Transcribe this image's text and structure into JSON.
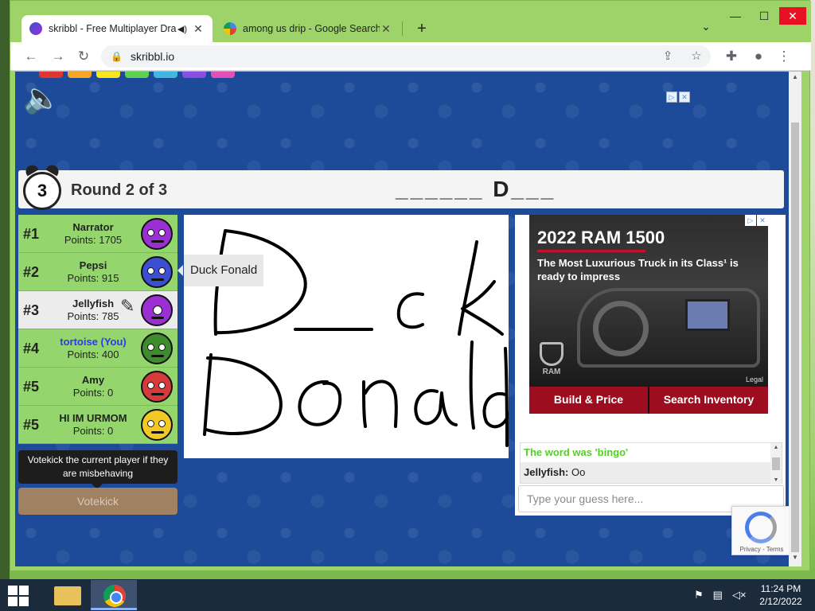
{
  "browser": {
    "tabs": [
      {
        "title": "skribbl - Free Multiplayer Dra",
        "active": true,
        "icon": "skribbl-favicon",
        "audio_icon": "speaker-icon"
      },
      {
        "title": "among us drip - Google Search",
        "active": false,
        "icon": "google-favicon"
      }
    ],
    "new_tab": "+",
    "url": "skribbl.io",
    "window_controls": {
      "minimize": "—",
      "maximize": "☐",
      "close": "✕"
    }
  },
  "game": {
    "timer": "3",
    "round_label": "Round 2 of 3",
    "word_hint": "______ D___",
    "players": [
      {
        "rank": "#1",
        "name": "Narrator",
        "points": "Points: 1705",
        "avatar_color": "#9b2fd4",
        "row": "green",
        "you": false,
        "drawing": false
      },
      {
        "rank": "#2",
        "name": "Pepsi",
        "points": "Points: 915",
        "avatar_color": "#3d4fd1",
        "row": "green",
        "you": false,
        "drawing": false
      },
      {
        "rank": "#3",
        "name": "Jellyfish",
        "points": "Points: 785",
        "avatar_color": "#9b2fd4",
        "row": "white",
        "you": false,
        "drawing": true
      },
      {
        "rank": "#4",
        "name": "tortoise (You)",
        "points": "Points: 400",
        "avatar_color": "#3e8c2c",
        "row": "green",
        "you": true,
        "drawing": false
      },
      {
        "rank": "#5",
        "name": "Amy",
        "points": "Points: 0",
        "avatar_color": "#d63a3a",
        "row": "green",
        "you": false,
        "drawing": false
      },
      {
        "rank": "#5",
        "name": "HI IM URMOM",
        "points": "Points: 0",
        "avatar_color": "#f2c824",
        "row": "green",
        "you": false,
        "drawing": false
      }
    ],
    "votekick_tooltip": "Votekick the current player if they are misbehaving",
    "votekick_button": "Votekick",
    "speech_bubble": "Duck Fonald",
    "chat": [
      {
        "text": "The word was 'bingo'",
        "type": "system"
      },
      {
        "author": "Jellyfish:",
        "text": " Oo",
        "type": "user"
      }
    ],
    "guess_placeholder": "Type your guess here..."
  },
  "ad": {
    "headline": "2022 RAM 1500",
    "subtext": "The Most Luxurious Truck in its Class¹ is ready to impress",
    "brand": "RAM",
    "legal": "Legal",
    "buttons": [
      "Build & Price",
      "Search Inventory"
    ]
  },
  "recaptcha": {
    "footer": "Privacy - Terms"
  },
  "taskbar": {
    "time": "11:24 PM",
    "date": "2/12/2022"
  },
  "colors": {
    "page_bg": "#1d4b9a",
    "player_row_green": "#95d56e",
    "player_row_white": "#ececec",
    "system_msg": "#56ce27",
    "ad_button": "#9c0e1f",
    "window_frame": "#9ed36a"
  }
}
